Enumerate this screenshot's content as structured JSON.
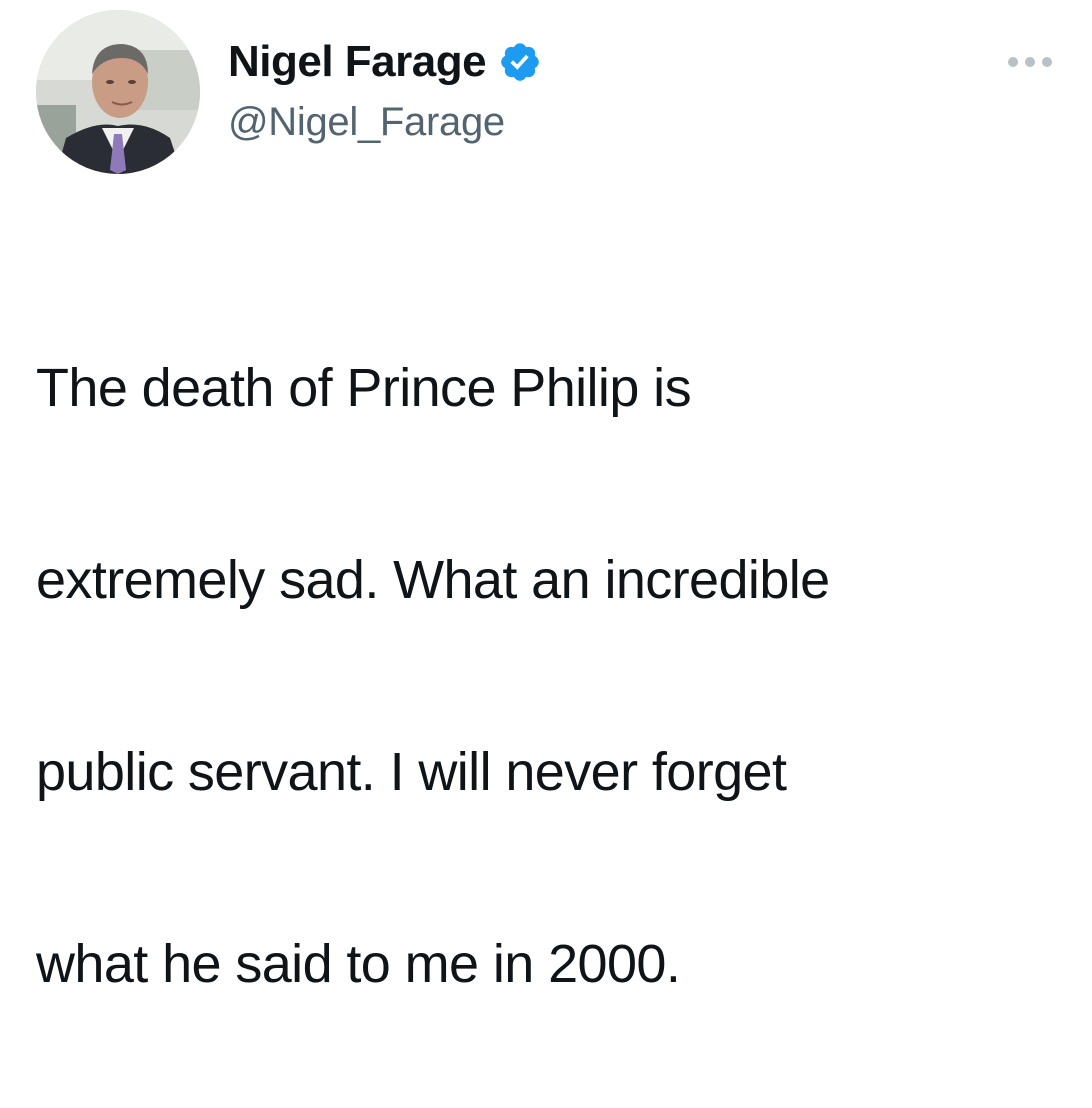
{
  "tweet": {
    "author": {
      "display_name": "Nigel Farage",
      "handle": "@Nigel_Farage",
      "verified": true,
      "avatar_icon": "profile-photo"
    },
    "more_icon": "ellipsis-icon",
    "text_lines": [
      "The death of Prince Philip is",
      "extremely sad. What an incredible",
      "public servant. I will never forget",
      "what he said to me in 2000."
    ]
  },
  "colors": {
    "text": "#0f1419",
    "secondary": "#536471",
    "verified_badge": "#1d9bf0"
  }
}
